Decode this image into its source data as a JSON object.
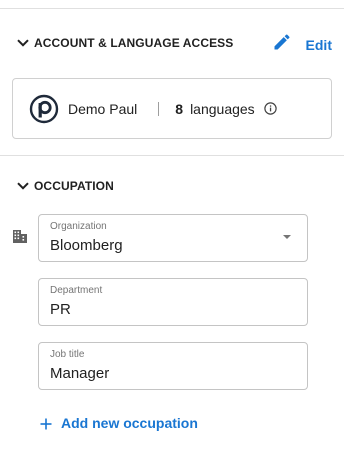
{
  "account_section": {
    "title": "ACCOUNT & LANGUAGE ACCESS",
    "edit_label": "Edit",
    "account_name": "Demo Paul",
    "language_count": "8",
    "language_label": "languages"
  },
  "occupation_section": {
    "title": "OCCUPATION",
    "fields": {
      "organization": {
        "label": "Organization",
        "value": "Bloomberg"
      },
      "department": {
        "label": "Department",
        "value": "PR"
      },
      "job_title": {
        "label": "Job title",
        "value": "Manager"
      }
    },
    "add_label": "Add new occupation"
  },
  "colors": {
    "accent": "#1976d2",
    "text": "#212121",
    "muted": "#757575",
    "border": "#c4c4c4"
  },
  "icons": {
    "section_toggle": "chevron-down-icon",
    "edit": "pencil-icon",
    "account_logo": "brand-logo-icon",
    "info": "info-icon",
    "organization": "building-icon",
    "dropdown": "caret-down-icon",
    "add": "plus-icon"
  }
}
